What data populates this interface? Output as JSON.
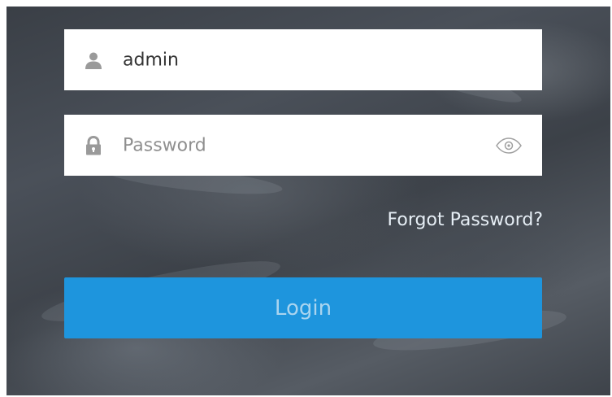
{
  "login_form": {
    "username": {
      "icon": "user-icon",
      "value": "admin"
    },
    "password": {
      "icon": "lock-icon",
      "placeholder": "Password",
      "toggle_icon": "eye-icon"
    },
    "forgot_password_label": "Forgot Password?",
    "login_label": "Login"
  },
  "colors": {
    "login_button": "#1e95dd",
    "login_text": "#a9d4ef",
    "icon_gray": "#9a9a9a"
  }
}
